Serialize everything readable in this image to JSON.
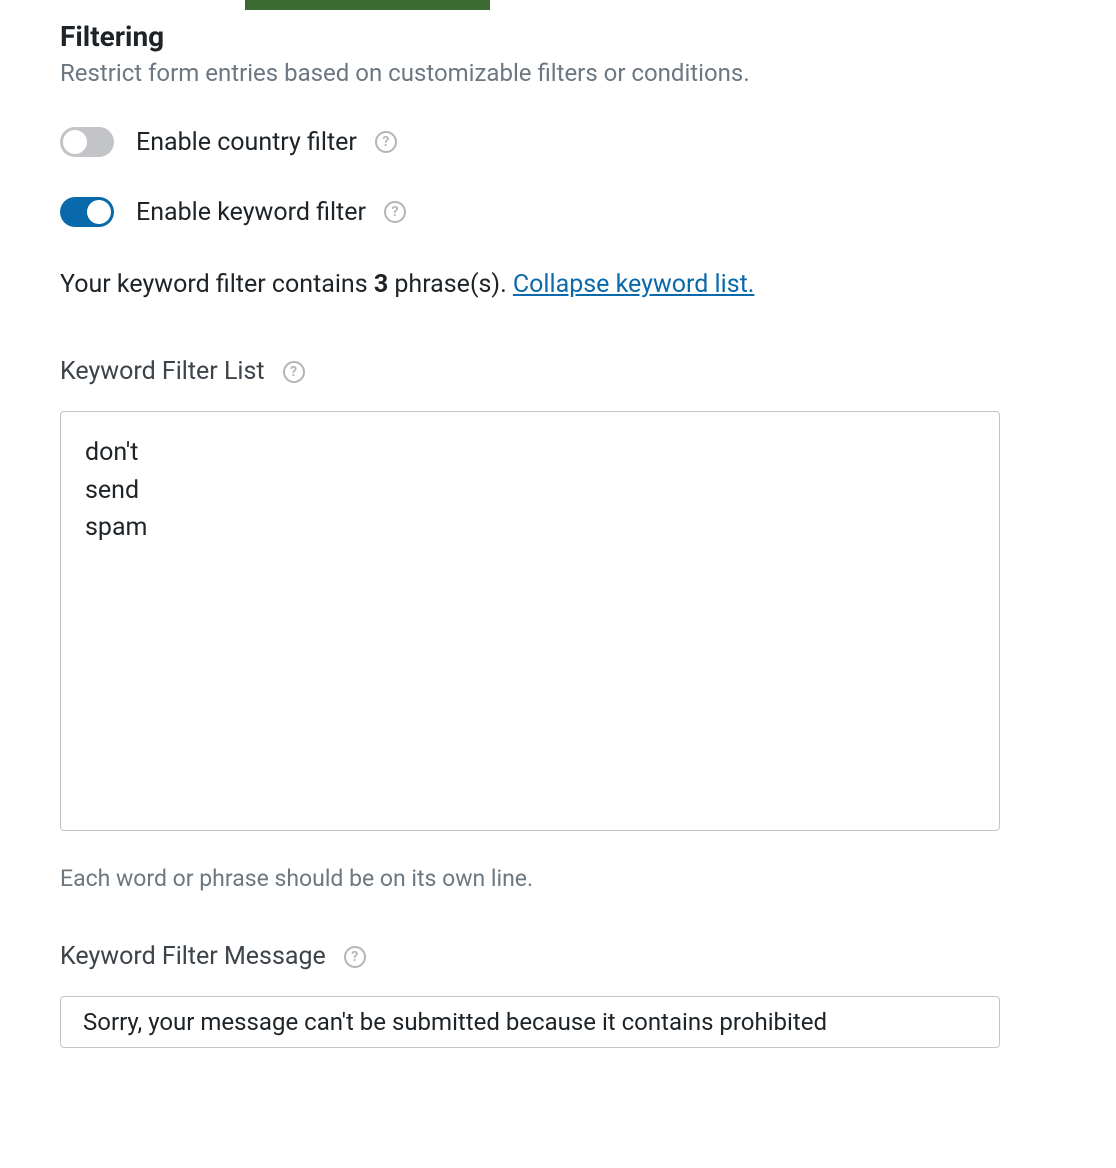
{
  "section": {
    "title": "Filtering",
    "description": "Restrict form entries based on customizable filters or conditions."
  },
  "toggles": {
    "country": {
      "label": "Enable country filter",
      "enabled": false
    },
    "keyword": {
      "label": "Enable keyword filter",
      "enabled": true
    }
  },
  "keyword_status": {
    "prefix": "Your keyword filter contains ",
    "count": "3",
    "suffix": " phrase(s). ",
    "link": "Collapse keyword list."
  },
  "filter_list": {
    "label": "Keyword Filter List",
    "value": "don't\nsend\nspam",
    "helper": "Each word or phrase should be on its own line."
  },
  "filter_message": {
    "label": "Keyword Filter Message",
    "value": "Sorry, your message can't be submitted because it contains prohibited"
  }
}
